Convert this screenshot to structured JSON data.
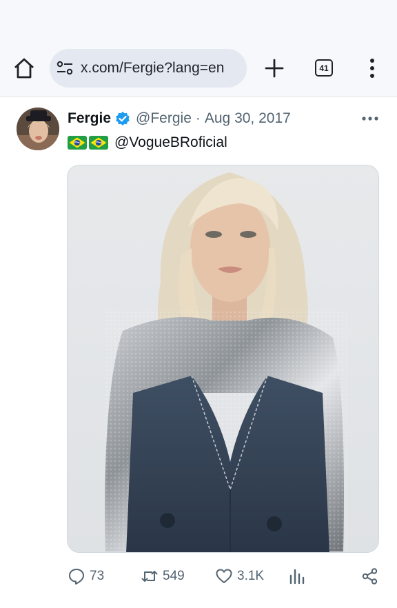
{
  "browser": {
    "url": "x.com/Fergie?lang=en",
    "tab_count": "41"
  },
  "post": {
    "author_name": "Fergie",
    "handle": "@Fergie",
    "separator": "·",
    "date": "Aug 30, 2017",
    "mention": "@VogueBRoficial",
    "flags": [
      "brazil-flag",
      "brazil-flag"
    ]
  },
  "actions": {
    "replies": "73",
    "reposts": "549",
    "likes": "3.1K"
  },
  "colors": {
    "verified": "#1d9bf0",
    "secondary_text": "#536471",
    "browser_bar": "#f7f8fc",
    "url_pill": "#e4e8f0"
  }
}
